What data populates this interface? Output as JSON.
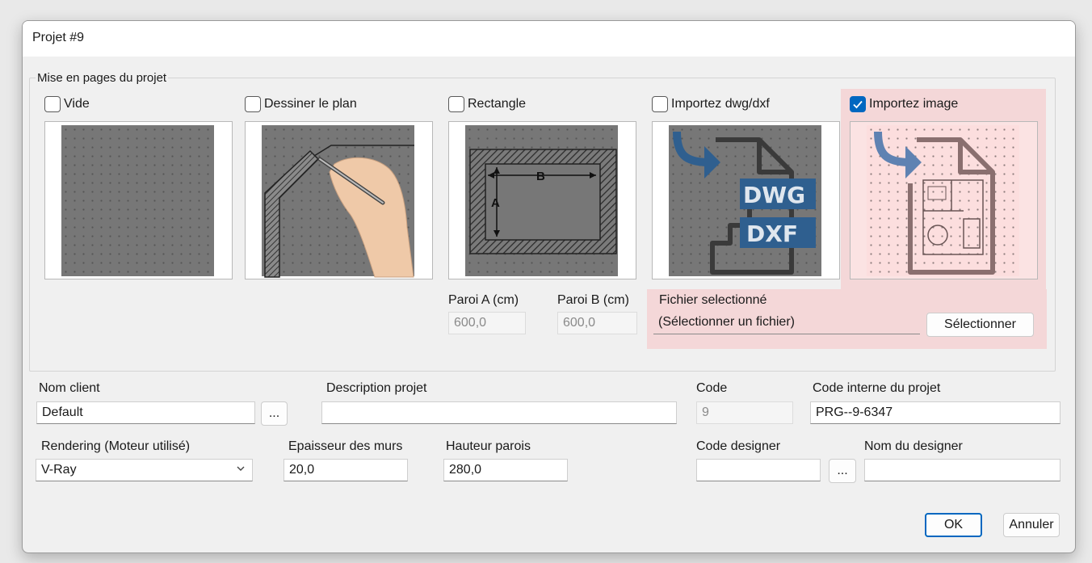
{
  "window": {
    "title": "Projet #9"
  },
  "layout_group": {
    "title": "Mise en pages du projet",
    "options": [
      {
        "label": "Vide",
        "checked": false,
        "icon": "empty-grid-icon"
      },
      {
        "label": "Dessiner le plan",
        "checked": false,
        "icon": "hand-drawing-icon"
      },
      {
        "label": "Rectangle",
        "checked": false,
        "icon": "rectangle-room-icon"
      },
      {
        "label": "Importez dwg/dxf",
        "checked": false,
        "icon": "dwg-dxf-import-icon"
      },
      {
        "label": "Importez image",
        "checked": true,
        "icon": "image-import-icon"
      }
    ],
    "rectangle_labels": {
      "a": "A",
      "b": "B"
    },
    "dwg_labels": {
      "dwg": "DWG",
      "dxf": "DXF"
    },
    "paroi_a": {
      "label": "Paroi A (cm)",
      "value": "600,0"
    },
    "paroi_b": {
      "label": "Paroi B (cm)",
      "value": "600,0"
    },
    "file": {
      "label": "Fichier selectionné",
      "value": "(Sélectionner un fichier)",
      "button": "Sélectionner"
    }
  },
  "fields": {
    "client": {
      "label": "Nom client",
      "value": "Default",
      "browse": "..."
    },
    "description": {
      "label": "Description projet",
      "value": ""
    },
    "code": {
      "label": "Code",
      "value": "9"
    },
    "internal_code": {
      "label": "Code interne du projet",
      "value": "PRG--9-6347"
    },
    "rendering": {
      "label": "Rendering (Moteur utilisé)",
      "value": "V-Ray"
    },
    "wall_thickness": {
      "label": "Epaisseur des murs",
      "value": "20,0"
    },
    "wall_height": {
      "label": "Hauteur parois",
      "value": "280,0"
    },
    "designer_code": {
      "label": "Code designer",
      "value": "",
      "browse": "..."
    },
    "designer_name": {
      "label": "Nom du designer",
      "value": ""
    }
  },
  "actions": {
    "ok": "OK",
    "cancel": "Annuler"
  },
  "colors": {
    "accent": "#0067c0",
    "highlight": "#f4d7d8",
    "arrow_blue": "#2f5f8f"
  }
}
